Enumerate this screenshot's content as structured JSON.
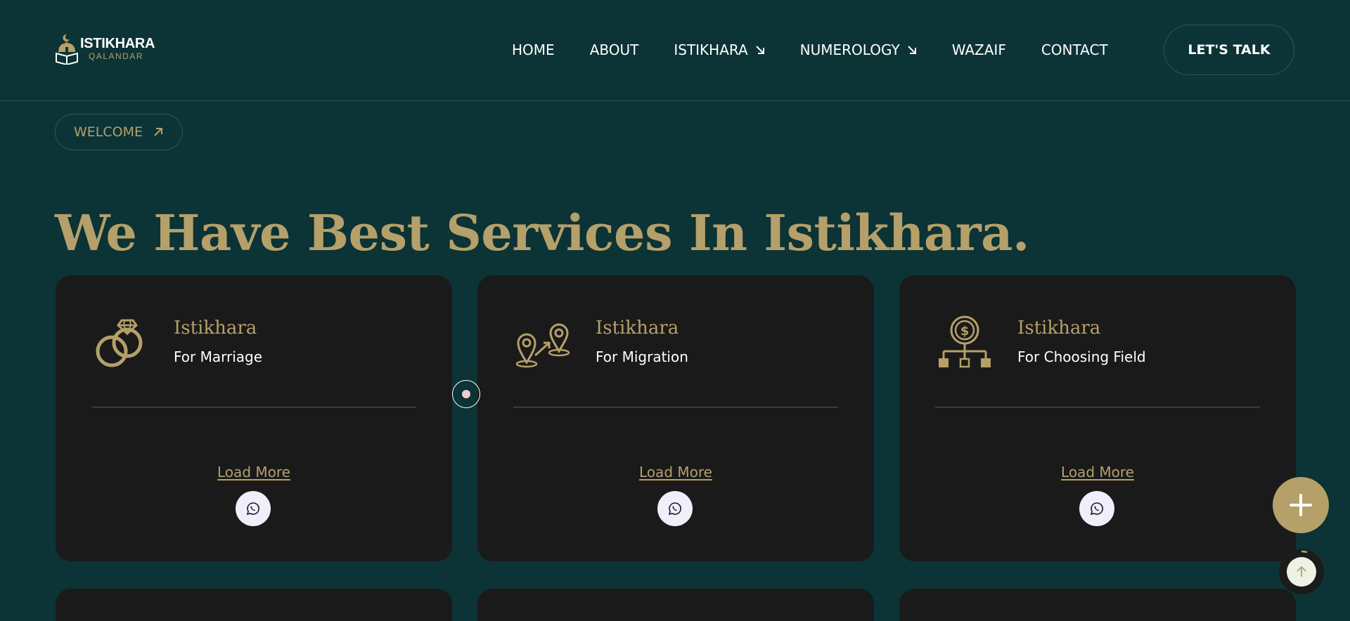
{
  "brand": {
    "name": "ISTIKHARA",
    "sub": "QALANDAR"
  },
  "nav": {
    "items": [
      {
        "label": "HOME",
        "has_arrow": false
      },
      {
        "label": "ABOUT",
        "has_arrow": false
      },
      {
        "label": "ISTIKHARA",
        "has_arrow": true
      },
      {
        "label": "NUMEROLOGY",
        "has_arrow": true
      },
      {
        "label": "WAZAIF",
        "has_arrow": false
      },
      {
        "label": "CONTACT",
        "has_arrow": false
      }
    ],
    "cta_label": "LET'S TALK"
  },
  "hero": {
    "badge_label": "WELCOME",
    "title": "We Have Best Services In Istikhara."
  },
  "services": [
    {
      "title": "Istikhara",
      "subtitle": "For Marriage",
      "icon": "rings-icon",
      "link_label": "Load More"
    },
    {
      "title": "Istikhara",
      "subtitle": "For Migration",
      "icon": "migration-pins-icon",
      "link_label": "Load More"
    },
    {
      "title": "Istikhara",
      "subtitle": "For Choosing Field",
      "icon": "dollar-hierarchy-icon",
      "link_label": "Load More"
    }
  ],
  "colors": {
    "background": "#0c3336",
    "accent_gold": "#b5a06a",
    "card": "#1a1a1a",
    "whatsapp_button": "#f1eefb"
  }
}
